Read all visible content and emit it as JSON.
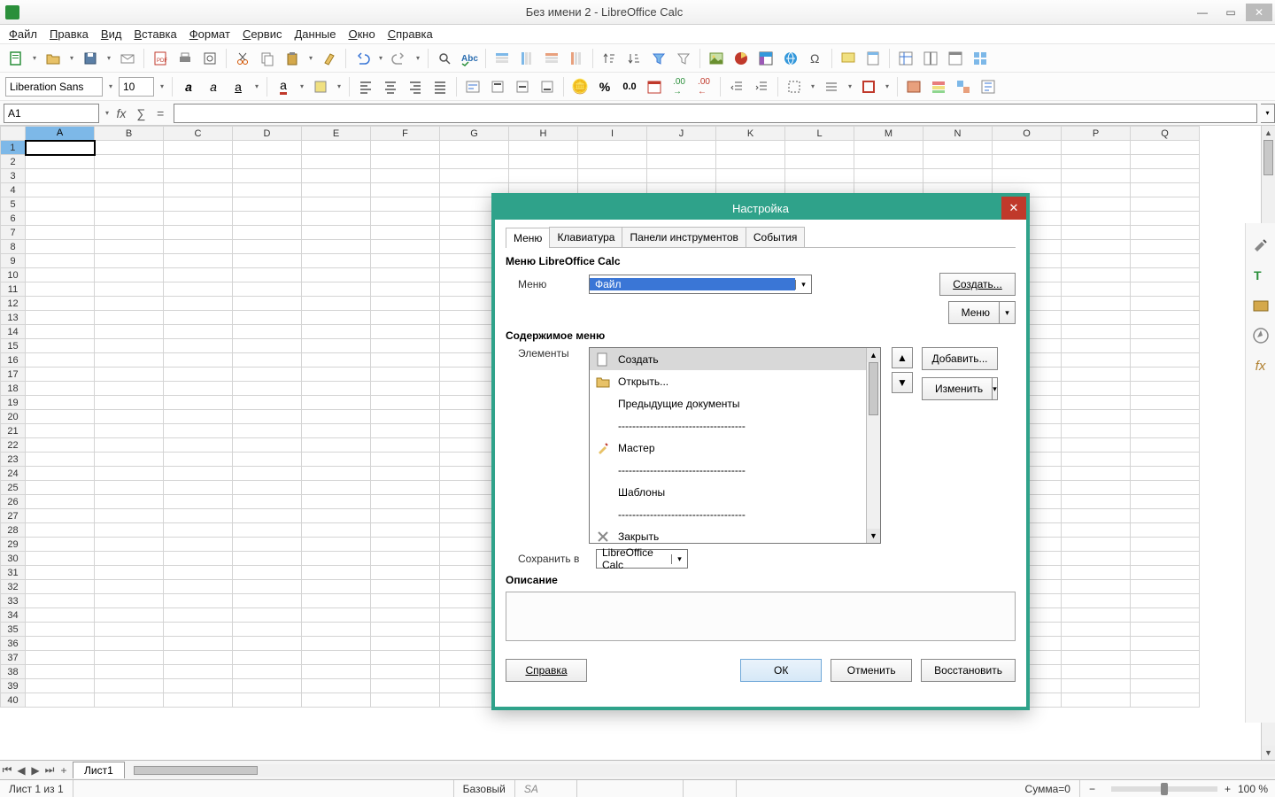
{
  "titlebar": {
    "title": "Без имени 2 - LibreOffice Calc"
  },
  "menubar": [
    "Файл",
    "Правка",
    "Вид",
    "Вставка",
    "Формат",
    "Сервис",
    "Данные",
    "Окно",
    "Справка"
  ],
  "toolbar2": {
    "font": "Liberation Sans",
    "size": "10"
  },
  "formulabar": {
    "cellref": "A1"
  },
  "columns": [
    "A",
    "B",
    "C",
    "D",
    "E",
    "F",
    "G",
    "H",
    "I",
    "J",
    "K",
    "L",
    "M",
    "N",
    "O",
    "P",
    "Q"
  ],
  "rows": 40,
  "sheettab": "Лист1",
  "status": {
    "sheetinfo": "Лист 1 из 1",
    "style": "Базовый",
    "sum": "Сумма=0",
    "zoom": "100 %"
  },
  "dialog": {
    "title": "Настройка",
    "tabs": [
      "Меню",
      "Клавиатура",
      "Панели инструментов",
      "События"
    ],
    "section1": "Меню LibreOffice Calc",
    "menu_label": "Меню",
    "menu_value": "Файл",
    "create_btn": "Создать...",
    "menu_btn": "Меню",
    "section2": "Содержимое меню",
    "elements_label": "Элементы",
    "add_btn": "Добавить...",
    "edit_btn": "Изменить",
    "items": [
      {
        "label": "Создать",
        "icon": "doc",
        "sel": true
      },
      {
        "label": "Открыть...",
        "icon": "open"
      },
      {
        "label": "Предыдущие документы",
        "icon": ""
      },
      {
        "label": "------------------------------------",
        "icon": ""
      },
      {
        "label": "Мастер",
        "icon": "wizard"
      },
      {
        "label": "------------------------------------",
        "icon": ""
      },
      {
        "label": "Шаблоны",
        "icon": "",
        "submenu": true
      },
      {
        "label": "------------------------------------",
        "icon": ""
      },
      {
        "label": "Закрыть",
        "icon": "close"
      }
    ],
    "savein_label": "Сохранить в",
    "savein_value": "LibreOffice Calc",
    "desc_label": "Описание",
    "help": "Справка",
    "ok": "ОК",
    "cancel": "Отменить",
    "restore": "Восстановить"
  }
}
